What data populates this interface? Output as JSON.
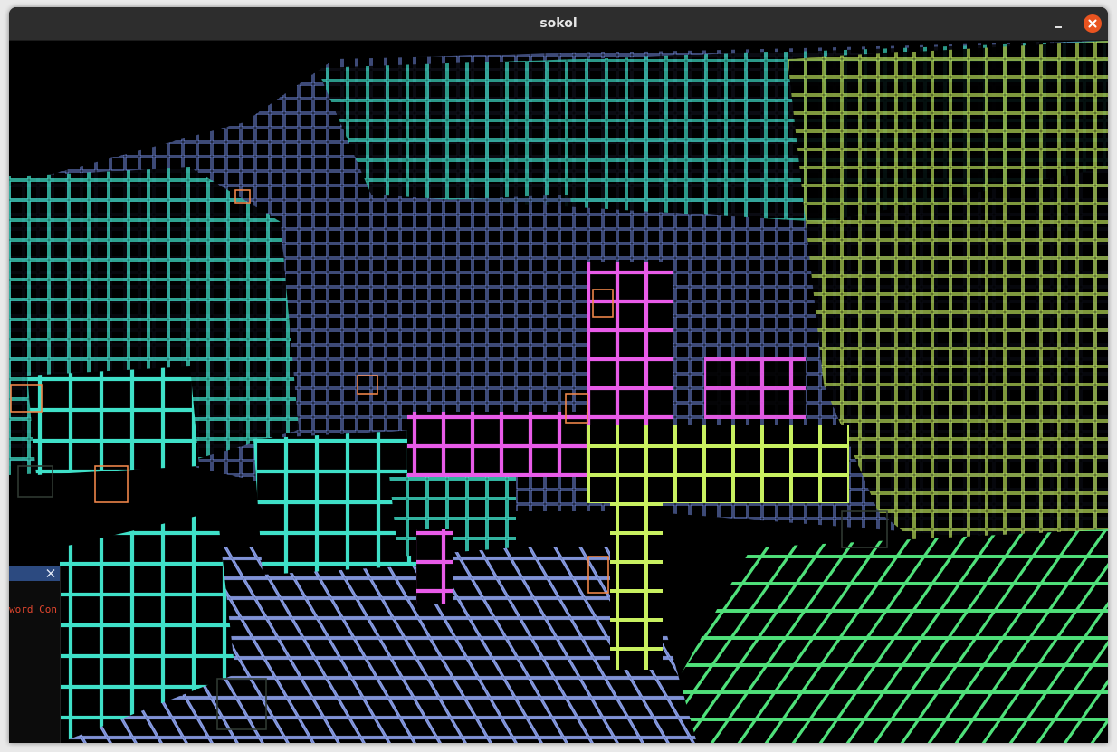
{
  "window": {
    "title": "sokol",
    "minimize_icon": "minimize-icon",
    "close_icon": "close-icon",
    "close_color": "#e95420"
  },
  "scene": {
    "description_icon": "voxel-render",
    "palette": [
      "#3fe0c8",
      "#6f86d8",
      "#c8f060",
      "#e85be8",
      "#f0864a",
      "#4fe07a"
    ]
  },
  "debug_panel": {
    "close_icon": "close-icon",
    "text": "word Con"
  }
}
